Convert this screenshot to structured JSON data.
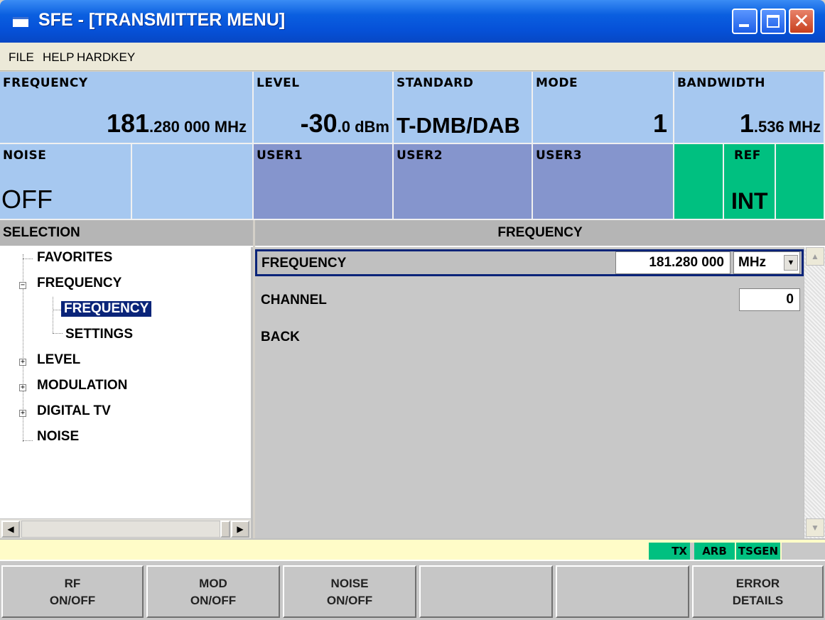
{
  "window": {
    "title": "SFE - [TRANSMITTER MENU]"
  },
  "menu": [
    "FILE",
    "HELP",
    "HARDKEY"
  ],
  "status": {
    "frequency": {
      "label": "FREQUENCY",
      "value_big": "181",
      "value_small": ".280 000 MHz"
    },
    "level": {
      "label": "LEVEL",
      "value_big": "-30",
      "value_small": ".0 dBm"
    },
    "standard": {
      "label": "STANDARD",
      "value": "T-DMB/DAB"
    },
    "mode": {
      "label": "MODE",
      "value": "1"
    },
    "bandwidth": {
      "label": "BANDWIDTH",
      "value_big": "1",
      "value_small": ".536 MHz"
    },
    "noise": {
      "label": "NOISE",
      "value": "OFF"
    },
    "user1": {
      "label": "USER1"
    },
    "user2": {
      "label": "USER2"
    },
    "user3": {
      "label": "USER3"
    },
    "ref": {
      "label": "REF",
      "value": "INT"
    }
  },
  "selection": {
    "header": "SELECTION",
    "tree": [
      "FAVORITES",
      "FREQUENCY",
      "FREQUENCY",
      "SETTINGS",
      "LEVEL",
      "MODULATION",
      "DIGITAL TV",
      "NOISE"
    ],
    "selected": "FREQUENCY"
  },
  "panel": {
    "header": "FREQUENCY",
    "frequency_label": "FREQUENCY",
    "frequency_value": "181.280 000",
    "frequency_unit": "MHz",
    "channel_label": "CHANNEL",
    "channel_value": "0",
    "back_label": "BACK"
  },
  "statusline": {
    "tags": [
      "TX",
      "ARB",
      "TSGEN"
    ]
  },
  "softkeys": [
    {
      "line1": "RF",
      "line2": "ON/OFF"
    },
    {
      "line1": "MOD",
      "line2": "ON/OFF"
    },
    {
      "line1": "NOISE",
      "line2": "ON/OFF"
    },
    {
      "line1": "",
      "line2": ""
    },
    {
      "line1": "",
      "line2": ""
    },
    {
      "line1": "ERROR",
      "line2": "DETAILS"
    }
  ]
}
